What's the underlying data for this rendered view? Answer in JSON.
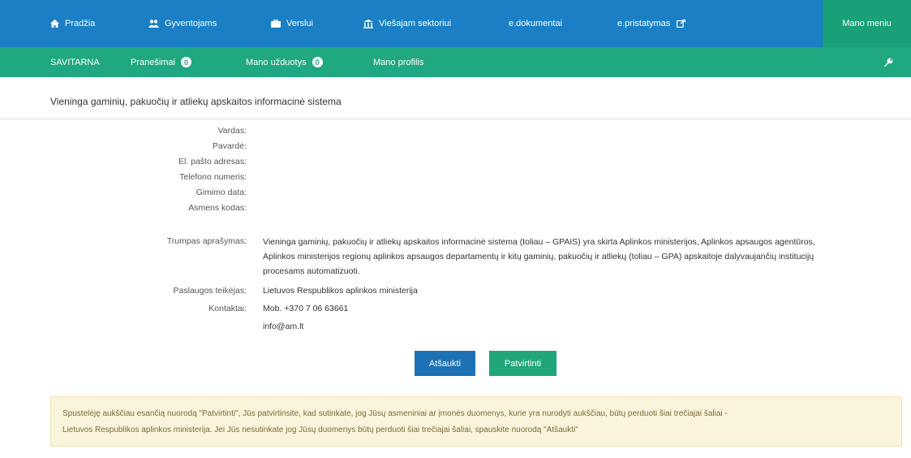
{
  "topnav": {
    "items": [
      {
        "label": "Pradžia",
        "icon": "home-icon"
      },
      {
        "label": "Gyventojams",
        "icon": "people-icon"
      },
      {
        "label": "Verslui",
        "icon": "briefcase-icon"
      },
      {
        "label": "Viešajam sektoriui",
        "icon": "institution-icon"
      },
      {
        "label": "e.dokumentai",
        "icon": ""
      },
      {
        "label": "e.pristatymas",
        "icon": "external-link-icon"
      }
    ],
    "my_menu": "Mano meniu"
  },
  "subnav": {
    "items": [
      {
        "label": "SAVITARNA"
      },
      {
        "label": "Pranešimai",
        "badge": "0"
      },
      {
        "label": "Mano užduotys",
        "badge": "0"
      },
      {
        "label": "Mano profilis"
      }
    ]
  },
  "page": {
    "title": "Vieninga gaminių, pakuočių ir atliekų apskaitos informacinė sistema"
  },
  "details": {
    "fields": [
      {
        "label": "Vardas:"
      },
      {
        "label": "Pavardė:"
      },
      {
        "label": "El. pašto adresas:"
      },
      {
        "label": "Telefono numeris:"
      },
      {
        "label": "Gimimo data:"
      },
      {
        "label": "Asmens kodas:"
      }
    ],
    "short_description_label": "Trumpas aprašymas:",
    "short_description_lines": [
      "Vieninga gaminių, pakuočių ir atliekų apskaitos informacinė sistema (toliau – GPAIS) yra skirta Aplinkos ministerijos, Aplinkos apsaugos agentūros,",
      "Aplinkos ministerijos regionų aplinkos apsaugos departamentų ir kitų gaminių, pakuočių ir atliekų (toliau – GPA) apskaitoje dalyvaujančių institucijų",
      "procesams automatizuoti."
    ],
    "provider_label": "Paslaugos teikėjas:",
    "provider_value": "Lietuvos Respublikos aplinkos ministerija",
    "contacts_label": "Kontaktai:",
    "contact_phone": "Mob. +370 7 06 63661",
    "contact_email": "info@am.lt"
  },
  "buttons": {
    "cancel": "Atšaukti",
    "confirm": "Patvirtinti"
  },
  "notice": {
    "line1": "Spustelėję aukščiau esančią nuorodą \"Patvirtinti\", Jūs patvirtinsite, kad sutinkate, jog Jūsų asmeniniai ar įmonės duomenys, kurie yra nurodyti aukščiau, būtų perduoti šiai trečiajai šaliai -",
    "line2": "Lietuvos Respublikos aplinkos ministerija. Jei Jūs nesutinkate jog Jūsų duomenys būtų perduoti šiai trečiajai šaliai, spauskite nuorodą \"Atšaukti\""
  },
  "colors": {
    "topnav_bg": "#1a7fc4",
    "subnav_bg": "#1fa882",
    "cancel_btn": "#1c72b5",
    "confirm_btn": "#20a67a",
    "notice_bg": "#fbf4dc"
  }
}
